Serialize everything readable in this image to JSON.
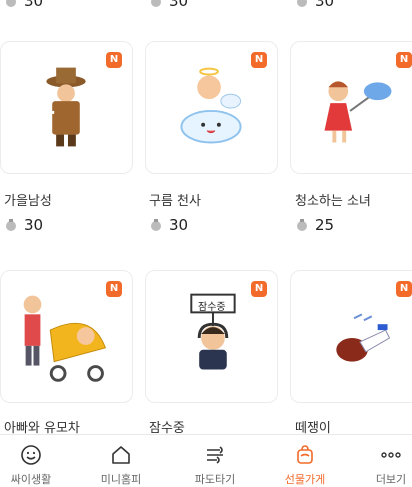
{
  "top_row_prices": [
    "30",
    "30",
    "30"
  ],
  "items": [
    {
      "name": "가을남성",
      "price": "30",
      "badge": "N"
    },
    {
      "name": "구름 천사",
      "price": "30",
      "badge": "N"
    },
    {
      "name": "청소하는 소녀",
      "price": "25",
      "badge": "N"
    },
    {
      "name": "아빠와 유모차",
      "badge": "N"
    },
    {
      "name": "잠수중",
      "badge": "N",
      "sign_text": "잠수중"
    },
    {
      "name": "떼쟁이",
      "badge": "N"
    }
  ],
  "tabs": [
    {
      "label": "싸이생활",
      "icon": "smiley-icon"
    },
    {
      "label": "미니홈피",
      "icon": "home-icon"
    },
    {
      "label": "파도타기",
      "icon": "wave-icon"
    },
    {
      "label": "선물가게",
      "icon": "gift-shop-icon",
      "active": true
    },
    {
      "label": "더보기",
      "icon": "more-dots-icon"
    }
  ],
  "colors": {
    "accent": "#f26b2a",
    "badge": "#f26b2a"
  }
}
